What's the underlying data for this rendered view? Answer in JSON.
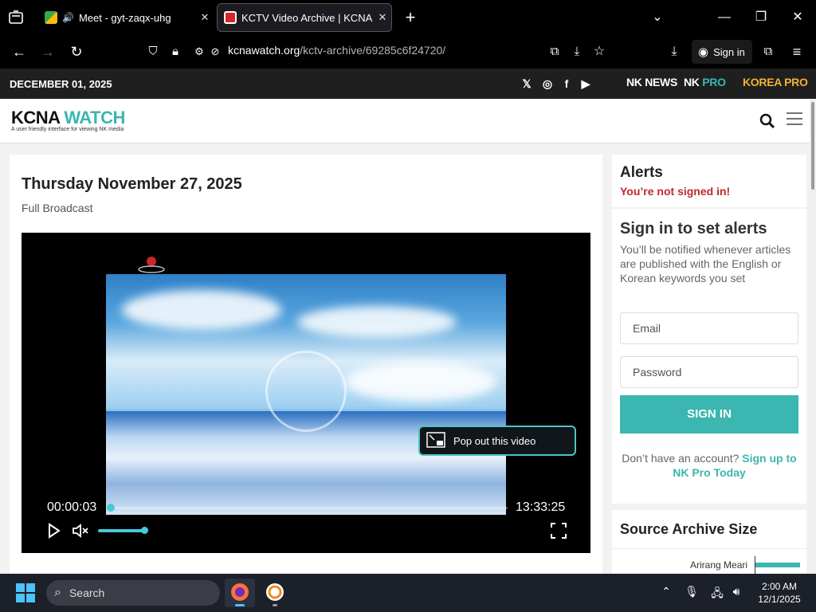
{
  "browser": {
    "tabs": [
      {
        "title": "Meet - gyt-zaqx-uhg",
        "close": "✕"
      },
      {
        "title": "KCTV Video Archive | KCNA Wat",
        "close": "✕"
      }
    ],
    "new_tab": "+",
    "url_domain": "kcnawatch.org",
    "url_path": "/kctv-archive/69285c6f24720/",
    "sign_in_label": "Sign in"
  },
  "site": {
    "date": "DECEMBER 01, 2025",
    "brands": {
      "nknews": "NK NEWS",
      "nkpro_nk": "NK",
      "nkpro_pro": "PRO",
      "korea": "KOREA",
      "korea_pro": "PRO"
    },
    "logo": {
      "part1": "KCNA",
      "part2": "WATCH",
      "tagline": "A user friendly interface for viewing NK media"
    }
  },
  "main": {
    "headline": "Thursday November 27, 2025",
    "subline": "Full Broadcast",
    "player": {
      "current_time": "00:00:03",
      "duration": "13:33:25",
      "popout_label": "Pop out this video",
      "progress_fraction": 0.002,
      "volume_fraction": 1.0
    }
  },
  "sidebar": {
    "alerts_title": "Alerts",
    "not_signed_in": "You’re not signed in!",
    "signin_title": "Sign in to set alerts",
    "signin_desc": "You’ll be notified whenever articles are published with the English or Korean keywords you set",
    "email_placeholder": "Email",
    "password_placeholder": "Password",
    "signin_button": "SIGN IN",
    "no_account": "Don’t have an account?",
    "signup_link": "Sign up to NK Pro Today",
    "archive_title": "Source Archive Size",
    "archive_label": "Arirang Meari"
  },
  "taskbar": {
    "search_label": "Search",
    "time": "2:00 AM",
    "date": "12/1/2025"
  },
  "colors": {
    "accent": "#3bb6b0",
    "alert": "#c0282d",
    "brand_nkpro": "#3bb6b0",
    "brand_korea": "#f2b233"
  }
}
